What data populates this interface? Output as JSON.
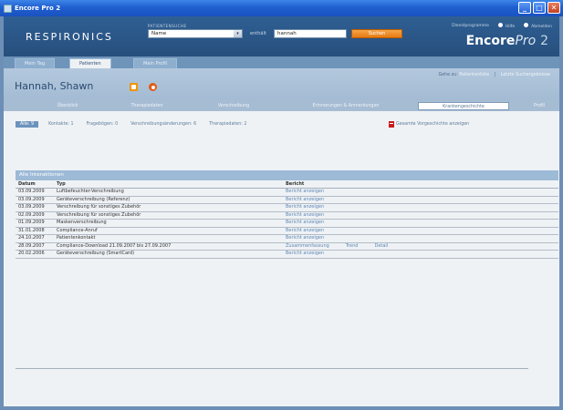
{
  "window": {
    "title": "Encore Pro 2",
    "buttons": [
      "_",
      "□",
      "✕"
    ]
  },
  "header": {
    "logo": "RESPIRONICS",
    "search_caption": "PATIENTENSUCHE",
    "search_type": "Name",
    "contains_label": "enthält",
    "search_value": "hannah",
    "search_button": "Suchen",
    "links": {
      "tools": "Dienstprogramme",
      "help": "Hilfe",
      "logout": "Abmelden"
    },
    "brand": {
      "name": "Encore",
      "pro": "Pro",
      "version": "2"
    }
  },
  "main_tabs": [
    "Mein Tag",
    "Patienten",
    "Mein Profil"
  ],
  "patient": {
    "name": "Hannah, Shawn",
    "goto_label": "Gehe zu:",
    "goto_links": [
      "Patientenliste",
      "Letzte Suchergebnisse"
    ]
  },
  "sub_tabs": [
    "Überblick",
    "Therapiedaten",
    "Verschreibung",
    "Erinnerungen & Anmerkungen",
    "Krankengeschichte",
    "Profil"
  ],
  "filters": {
    "all": "Alle: 9",
    "items": [
      "Kontakte: 1",
      "Fragebögen: 0",
      "Verschreibungsänderungen: 6",
      "Therapiedaten: 2"
    ],
    "history_link": "Gesamte Vorgeschichte anzeigen"
  },
  "interactions": {
    "title": "Alle Interaktionen",
    "columns": [
      "Datum",
      "Typ",
      "Bericht"
    ],
    "rows": [
      {
        "date": "03.09.2009",
        "type": "Luftbefeuchter-Verschreibung",
        "report": [
          "Bericht anzeigen"
        ]
      },
      {
        "date": "03.09.2009",
        "type": "Geräteverschreibung (Referenz)",
        "report": [
          "Bericht anzeigen"
        ]
      },
      {
        "date": "03.09.2009",
        "type": "Verschreibung für sonstiges Zubehör",
        "report": [
          "Bericht anzeigen"
        ]
      },
      {
        "date": "02.09.2009",
        "type": "Verschreibung für sonstiges Zubehör",
        "report": [
          "Bericht anzeigen"
        ]
      },
      {
        "date": "01.09.2009",
        "type": "Maskenverschreibung",
        "report": [
          "Bericht anzeigen"
        ]
      },
      {
        "date": "31.01.2008",
        "type": "Compliance-Anruf",
        "report": [
          "Bericht anzeigen"
        ]
      },
      {
        "date": "24.10.2007",
        "type": "Patientenkontakt",
        "report": [
          "Bericht anzeigen"
        ]
      },
      {
        "date": "28.09.2007",
        "type": "Compliance-Download 21.09.2007 bis 27.09.2007",
        "report": [
          "Zusammenfassung",
          "Trend",
          "Detail"
        ]
      },
      {
        "date": "20.02.2006",
        "type": "Geräteverschreibung (SmartCard)",
        "report": [
          "Bericht anzeigen"
        ]
      }
    ]
  }
}
